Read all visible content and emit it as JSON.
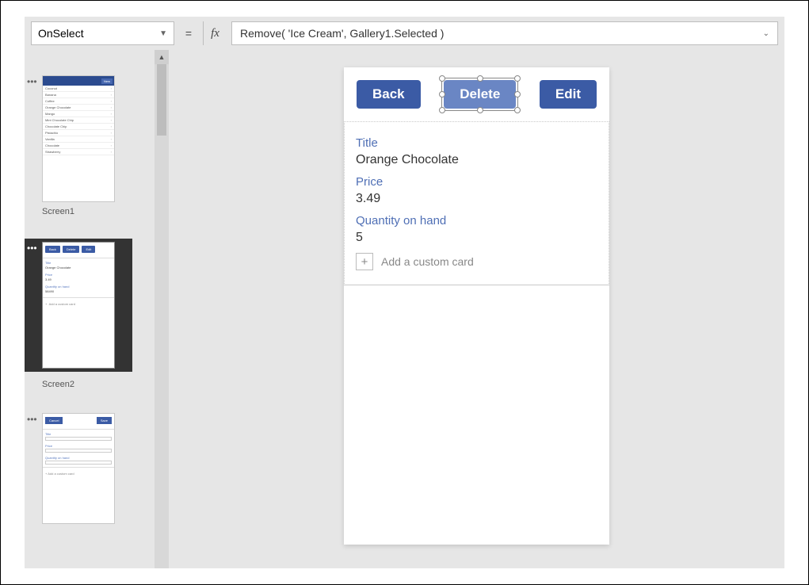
{
  "formula_bar": {
    "property": "OnSelect",
    "fx_label": "fx",
    "formula": "Remove( 'Ice Cream', Gallery1.Selected )"
  },
  "thumbnails": {
    "screen1": {
      "label": "Screen1",
      "new_btn": "New",
      "items": [
        "Coconut",
        "Banana",
        "Coffee",
        "Orange Chocolate",
        "Mango",
        "Mint Chocolate Chip",
        "Chocolate Chip",
        "Pistachio",
        "Vanilla",
        "Chocolate",
        "Strawberry"
      ]
    },
    "screen2": {
      "label": "Screen2",
      "buttons": {
        "back": "Back",
        "delete": "Delete",
        "edit": "Edit"
      },
      "title_lbl": "Title",
      "title_val": "Orange Chocolate",
      "price_lbl": "Price",
      "price_val": "3.49",
      "qty_lbl": "Quantity on hand",
      "qty_val": "58490",
      "add": "Add a custom card"
    },
    "screen3": {
      "buttons": {
        "cancel": "Cancel",
        "save": "Save"
      },
      "title_lbl": "Title",
      "price_lbl": "Price",
      "qty_lbl": "Quantity on hand",
      "add": "+  Add a custom card"
    }
  },
  "canvas": {
    "buttons": {
      "back": "Back",
      "delete": "Delete",
      "edit": "Edit"
    },
    "title_lbl": "Title",
    "title_val": "Orange Chocolate",
    "price_lbl": "Price",
    "price_val": "3.49",
    "qty_lbl": "Quantity on hand",
    "qty_val": "5",
    "add": "Add a custom card"
  }
}
